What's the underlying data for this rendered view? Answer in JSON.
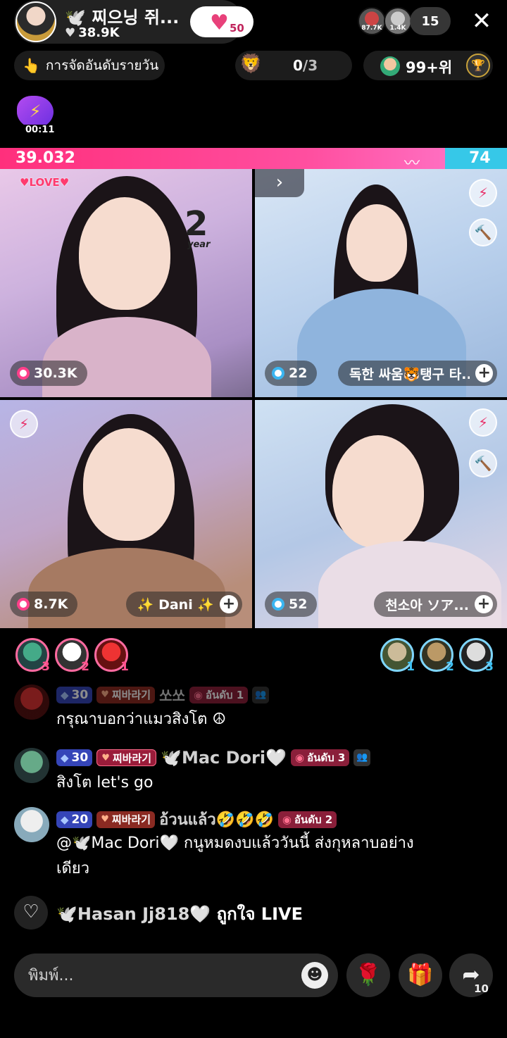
{
  "header": {
    "host_name": "🕊️ 찌으닝 쥐...",
    "host_likes": "38.9K",
    "follow_count": "50",
    "viewer_avatars": [
      "87.7K",
      "1.4K"
    ],
    "viewer_count": "15"
  },
  "subheader": {
    "daily_rank_label": "การจัดอันดับรายวัน",
    "quest_progress": "0",
    "quest_total": "/3",
    "position": "99+위"
  },
  "timer": "00:11",
  "battle": {
    "left_score": "39.032",
    "right_score": "74",
    "colors": {
      "left": "#ff2f7c",
      "right": "#36c8e8"
    }
  },
  "tiles": [
    {
      "score": "30.3K",
      "team": "pink",
      "sticker_year": "2",
      "sticker_year_label": "year",
      "love_label": "LOVE"
    },
    {
      "score": "22",
      "team": "blue",
      "name": "독한 싸움🐯탱구 타..."
    },
    {
      "score": "8.7K",
      "team": "pink",
      "name": "✨ Dani ✨"
    },
    {
      "score": "52",
      "team": "blue",
      "name": "천소아 ソア..."
    }
  ],
  "gifters_left": [
    "3",
    "2",
    "1"
  ],
  "gifters_right": [
    "1",
    "2",
    "3"
  ],
  "chat": [
    {
      "level": "30",
      "fan": "찌바라기",
      "user": "쏘쏘",
      "rank": "อันดับ 1",
      "text": "กรุณาบอกว่าแมวสิงโต ☮"
    },
    {
      "level": "30",
      "fan": "찌바라기",
      "user": "🕊️Mac Dori🤍",
      "rank": "อันดับ 3",
      "text": "สิงโต let's go"
    },
    {
      "level": "20",
      "fan": "찌바라기",
      "user": "อ้วนแล้ว🤣🤣🤣",
      "rank": "อันดับ 2",
      "text_line1": "@🕊️Mac Dori🤍 กนูหมดงบแล้ววันนี้ ส่งกุหลาบอย่าง",
      "text_line2": "เดียว"
    }
  ],
  "like_line": {
    "user": "🕊️Hasan Jj818🤍",
    "action": "ถูกใจ LIVE"
  },
  "bottom": {
    "input_placeholder": "พิมพ์...",
    "share_count": "10"
  }
}
